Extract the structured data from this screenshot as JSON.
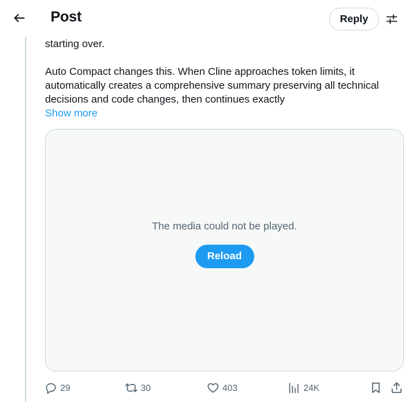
{
  "header": {
    "title": "Post",
    "reply_label": "Reply",
    "back_icon": "arrow-left-icon",
    "filter_icon": "sliders-icon"
  },
  "post": {
    "text_line_1": "starting over.",
    "text_para_2": "Auto Compact changes this. When Cline approaches token limits, it automatically creates a comprehensive summary preserving all technical decisions and code changes, then continues exactly",
    "show_more": "Show more"
  },
  "media": {
    "message": "The media could not be played.",
    "reload_label": "Reload"
  },
  "actions": {
    "replies": "29",
    "reposts": "30",
    "likes": "403",
    "views": "24K"
  },
  "colors": {
    "accent": "#1d9bf0",
    "text": "#0f1419",
    "muted": "#536471",
    "border": "#cfd9de"
  }
}
